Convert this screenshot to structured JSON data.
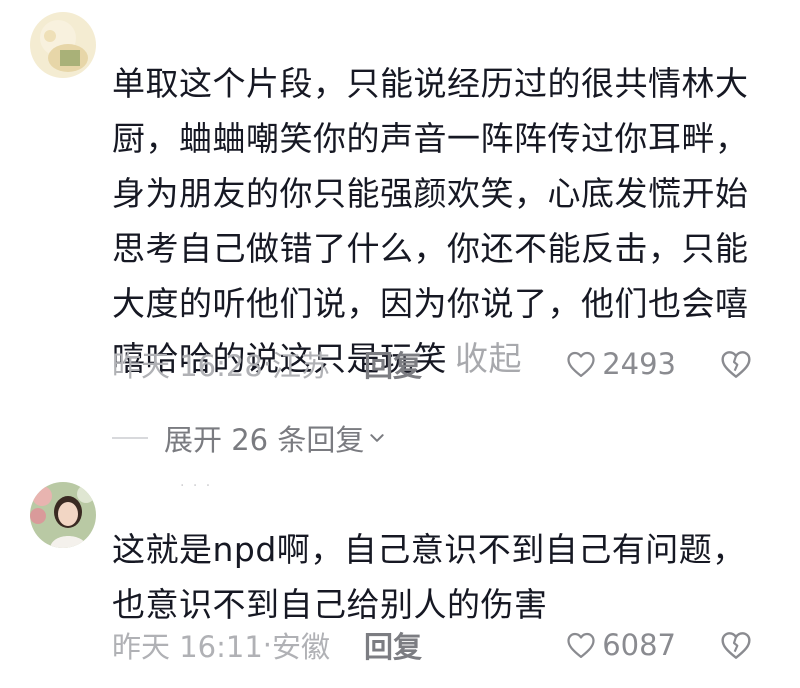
{
  "comments": [
    {
      "text": "单取这个片段，只能说经历过的很共情林大厨，蛐蛐嘲笑你的声音一阵阵传过你耳畔，身为朋友的你只能强颜欢笑，心底发慌开始思考自己做错了什么，你还不能反击，只能大度的听他们说，因为你说了，他们也会嘻嘻哈哈的说这只是玩笑",
      "collapse_label": "收起",
      "time": "昨天 16:28",
      "location": "江苏",
      "reply_label": "回复",
      "likes": "2493",
      "expand_label": "展开 26 条回复"
    },
    {
      "text": "这就是npd啊，自己意识不到自己有问题，也意识不到自己给别人的伤害",
      "time": "昨天 16:11",
      "location": "安徽",
      "reply_label": "回复",
      "likes": "6087"
    }
  ],
  "colors": {
    "text": "#161823",
    "meta": "#a2a3a8",
    "reply": "#7c7d82"
  },
  "icons": [
    "heart-outline-icon",
    "dislike-heart-icon",
    "chevron-down-icon"
  ]
}
